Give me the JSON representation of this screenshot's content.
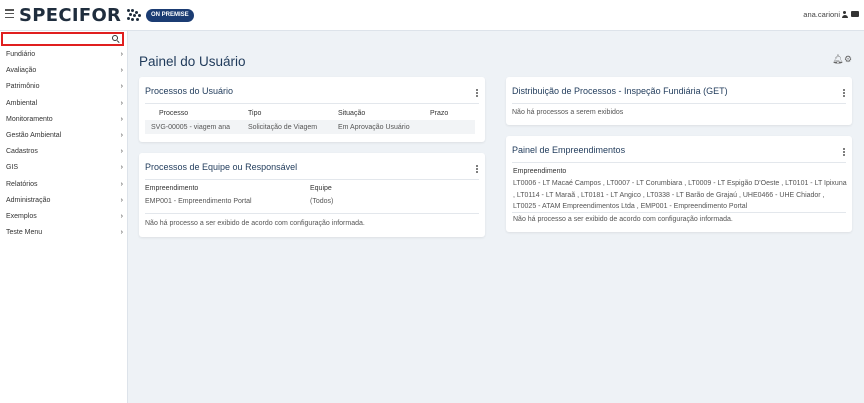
{
  "header": {
    "brand": "SPECIFOR",
    "badge": "ON PREMISE",
    "user": "ana.carioni"
  },
  "sidebar": {
    "search_placeholder": "",
    "items": [
      {
        "label": "Fundiário"
      },
      {
        "label": "Avaliação"
      },
      {
        "label": "Patrimônio"
      },
      {
        "label": "Ambiental"
      },
      {
        "label": "Monitoramento"
      },
      {
        "label": "Gestão Ambiental"
      },
      {
        "label": "Cadastros"
      },
      {
        "label": "GIS"
      },
      {
        "label": "Relatórios"
      },
      {
        "label": "Administração"
      },
      {
        "label": "Exemplos"
      },
      {
        "label": "Teste Menu"
      }
    ],
    "chevron": "›"
  },
  "main": {
    "title": "Painel do Usuário",
    "icons": [
      "bell-icon",
      "gears-icon"
    ]
  },
  "cards": {
    "processos_usuario": {
      "title": "Processos do Usuário",
      "columns": [
        "Processo",
        "Tipo",
        "Situação",
        "Prazo"
      ],
      "rows": [
        [
          "SVG-00005 - viagem ana",
          "Solicitação de Viagem",
          "Em Aprovação Usuário",
          ""
        ]
      ]
    },
    "processos_equipe": {
      "title": "Processos de Equipe ou Responsável",
      "col_empreendimento": "Empreendimento",
      "col_equipe": "Equipe",
      "val_empreendimento": "EMP001 - Empreendimento Portal",
      "val_equipe": "(Todos)",
      "message": "Não há processo a ser exibido de acordo com configuração informada."
    },
    "distribuicao": {
      "title": "Distribuição de Processos - Inspeção Fundiária (GET)",
      "message": "Não há processos a serem exibidos"
    },
    "empreendimentos": {
      "title": "Painel de Empreendimentos",
      "label": "Empreendimento",
      "list": "LT0006 - LT Macaé Campos , LT0007 - LT Corumbiara , LT0009 - LT Espigão D'Oeste , LT0101 - LT Ipixuna , LT0114 - LT Maraã , LT0181 - LT Angico , LT0338 - LT Barão de Grajaú , UHE0466 - UHE Chiador , LT0025 - ATAM Empreendimentos Ltda , EMP001 - Empreendimento Portal",
      "message": "Não há processo a ser exibido de acordo com configuração informada."
    }
  }
}
